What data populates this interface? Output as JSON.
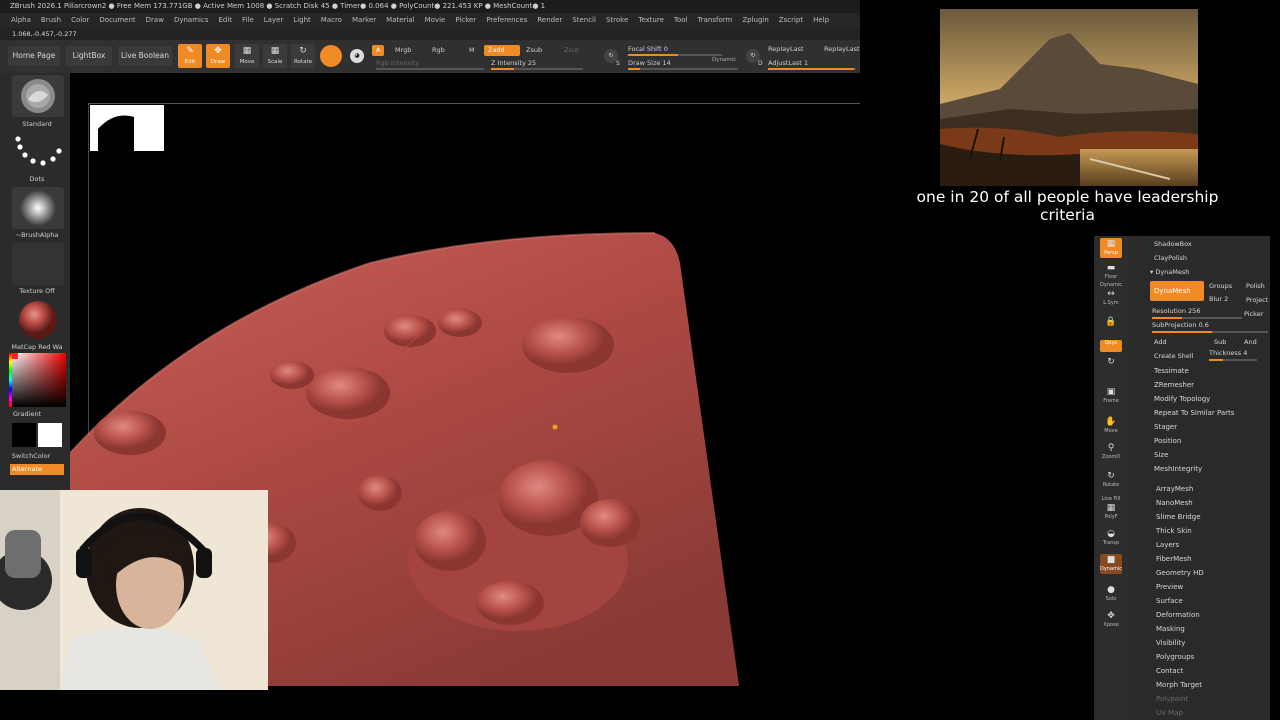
{
  "titlebar": {
    "text": "ZBrush 2026.1     Pillarcrown2     ● Free Mem 173.771GB ● Active Mem 1008 ● Scratch Disk 45 ●  Timer● 0.064 ● PolyCount● 221.453 KP  ● MeshCount● 1"
  },
  "menu": [
    "Alpha",
    "Brush",
    "Color",
    "Document",
    "Draw",
    "Dynamics",
    "Edit",
    "File",
    "Layer",
    "Light",
    "Macro",
    "Marker",
    "Material",
    "Movie",
    "Picker",
    "Preferences",
    "Render",
    "Stencil",
    "Stroke",
    "Texture",
    "Tool",
    "Transform",
    "Zplugin",
    "Zscript",
    "Help"
  ],
  "coords": "1.068,-0.457,-0.277",
  "shelf": {
    "home": "Home Page",
    "lightbox": "LightBox",
    "live_boolean": "Live Boolean",
    "edit": "Edit",
    "draw": "Draw",
    "move": "Move",
    "scale": "Scale",
    "rotate": "Rotate",
    "a": "A",
    "mrgb": "Mrgb",
    "rgb": "Rgb",
    "m": "M",
    "zadd": "Zadd",
    "zsub": "Zsub",
    "zcut": "Zcut",
    "rgb_intensity": "Rgb Intensity",
    "z_intensity_label": "Z Intensity",
    "z_intensity": "25",
    "focal_shift_label": "Focal Shift",
    "focal_shift": "0",
    "draw_size_label": "Draw Size",
    "draw_size": "14",
    "dynamic": "Dynamic",
    "replay_last": "ReplayLast",
    "replay_last_rel": "ReplayLast",
    "adjust_last_label": "AdjustLast",
    "adjust_last": "1",
    "s": "S",
    "d": "D"
  },
  "tray": {
    "brush": "Standard",
    "stroke": "Dots",
    "alpha": "~BrushAlpha",
    "texture": "Texture Off",
    "material": "MatCap Red Wa",
    "gradient": "Gradient",
    "switch_color": "SwitchColor",
    "alternate": "Alternate"
  },
  "right_strip": [
    "Persp",
    "Floor",
    "Dynamic",
    "L.Sym",
    "",
    "Qxyz",
    "",
    "",
    "Frame",
    "Move",
    "ZoomD",
    "Rotate",
    "Line Fill",
    "PolyF",
    "Transp",
    "",
    "Dynamic",
    "Solo",
    "Xpose"
  ],
  "dynamesh": {
    "shadowbox": "ShadowBox",
    "claypolish": "ClayPolish",
    "header": "▾ DynaMesh",
    "dynamesh_btn": "DynaMesh",
    "groups": "Groups",
    "polish": "Polish",
    "blur": "Blur",
    "blur_val": "2",
    "project": "Project",
    "resolution_label": "Resolution",
    "resolution": "256",
    "picker": "Picker",
    "subprojection_label": "SubProjection",
    "subprojection": "0.6",
    "add": "Add",
    "sub": "Sub",
    "and": "And",
    "create_shell": "Create Shell",
    "thickness_label": "Thickness",
    "thickness": "4"
  },
  "right_items": [
    "Tessimate",
    "ZRemesher",
    "Modify Topology",
    "Repeat To Similar Parts",
    "Stager",
    "Position",
    "Size",
    "MeshIntegrity"
  ],
  "right_items2": [
    "ArrayMesh",
    "NanoMesh",
    "Slime Bridge",
    "Thick Skin",
    "Layers",
    "FiberMesh",
    "Geometry HD",
    "Preview",
    "Surface",
    "Deformation",
    "Masking",
    "Visibility",
    "Polygroups",
    "Contact",
    "Morph Target",
    "Polypaint",
    "UV Map"
  ],
  "caption": "one in 20 of all people have leadership criteria",
  "colors": {
    "accent": "#f08a24",
    "clay": "#b8504a"
  }
}
